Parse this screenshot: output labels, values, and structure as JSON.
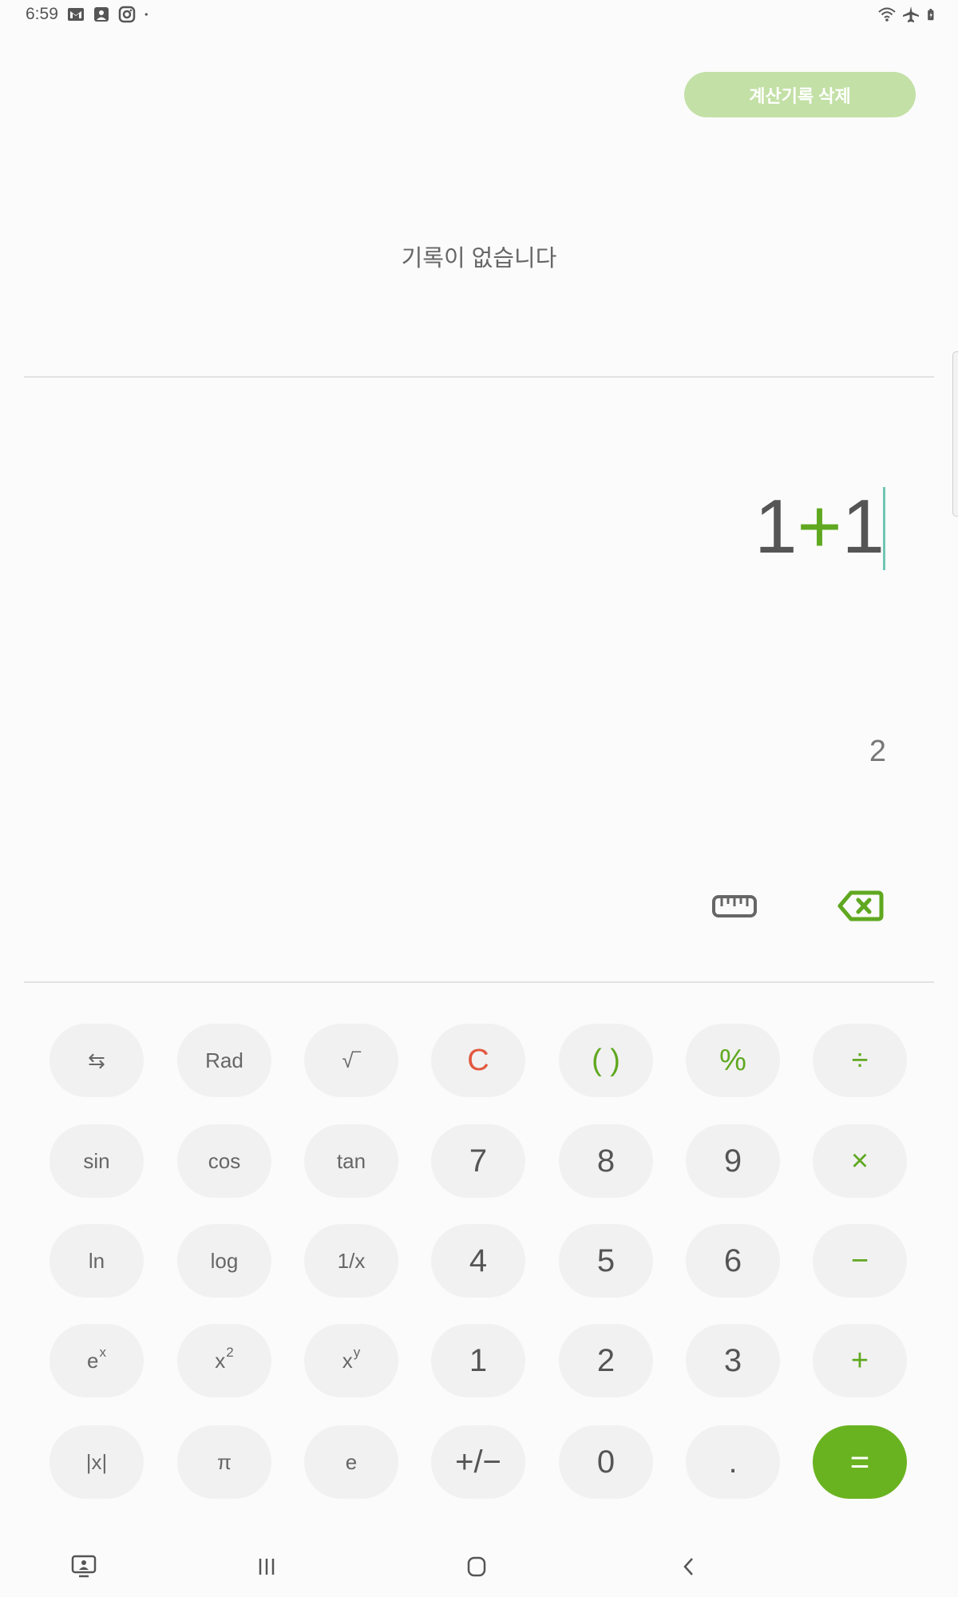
{
  "status_bar": {
    "time": "6:59",
    "left_icons": [
      "gmail-icon",
      "image-notification-icon",
      "instagram-icon",
      "notification-dot-icon"
    ],
    "right_icons": [
      "wifi-icon",
      "airplane-mode-icon",
      "battery-icon"
    ]
  },
  "history": {
    "clear_label": "계산기록 삭제",
    "empty_text": "기록이 없습니다"
  },
  "display": {
    "expression_parts": [
      "1",
      "+",
      "1"
    ],
    "result": "2"
  },
  "keypad": {
    "rows": [
      [
        {
          "label": "⇆",
          "kind": "fn",
          "name": "swap-keypad-key"
        },
        {
          "label": "Rad",
          "kind": "fn",
          "name": "rad-key"
        },
        {
          "label": "√‾",
          "kind": "fn",
          "name": "sqrt-key"
        },
        {
          "label": "C",
          "kind": "clear",
          "name": "clear-key"
        },
        {
          "label": "( )",
          "kind": "op",
          "name": "parentheses-key"
        },
        {
          "label": "%",
          "kind": "op",
          "name": "percent-key"
        },
        {
          "label": "÷",
          "kind": "op",
          "name": "divide-key"
        }
      ],
      [
        {
          "label": "sin",
          "kind": "fn",
          "name": "sin-key"
        },
        {
          "label": "cos",
          "kind": "fn",
          "name": "cos-key"
        },
        {
          "label": "tan",
          "kind": "fn",
          "name": "tan-key"
        },
        {
          "label": "7",
          "kind": "num",
          "name": "digit-7-key"
        },
        {
          "label": "8",
          "kind": "num",
          "name": "digit-8-key"
        },
        {
          "label": "9",
          "kind": "num",
          "name": "digit-9-key"
        },
        {
          "label": "×",
          "kind": "op",
          "name": "multiply-key"
        }
      ],
      [
        {
          "label": "ln",
          "kind": "fn",
          "name": "ln-key"
        },
        {
          "label": "log",
          "kind": "fn",
          "name": "log-key"
        },
        {
          "label": "1/x",
          "kind": "fn",
          "name": "reciprocal-key"
        },
        {
          "label": "4",
          "kind": "num",
          "name": "digit-4-key"
        },
        {
          "label": "5",
          "kind": "num",
          "name": "digit-5-key"
        },
        {
          "label": "6",
          "kind": "num",
          "name": "digit-6-key"
        },
        {
          "label": "−",
          "kind": "op",
          "name": "minus-key"
        }
      ],
      [
        {
          "label": "e",
          "sup": "x",
          "kind": "fn",
          "name": "exp-key"
        },
        {
          "label": "x",
          "sup": "2",
          "kind": "fn",
          "name": "square-key"
        },
        {
          "label": "x",
          "sup": "y",
          "kind": "fn",
          "name": "power-key"
        },
        {
          "label": "1",
          "kind": "num",
          "name": "digit-1-key"
        },
        {
          "label": "2",
          "kind": "num",
          "name": "digit-2-key"
        },
        {
          "label": "3",
          "kind": "num",
          "name": "digit-3-key"
        },
        {
          "label": "+",
          "kind": "op",
          "name": "plus-key"
        }
      ],
      [
        {
          "label": "|x|",
          "kind": "fn",
          "name": "abs-key"
        },
        {
          "label": "π",
          "kind": "fn",
          "name": "pi-key"
        },
        {
          "label": "e",
          "kind": "fn",
          "name": "euler-key"
        },
        {
          "label": "+/−",
          "kind": "num",
          "name": "sign-toggle-key"
        },
        {
          "label": "0",
          "kind": "num",
          "name": "digit-0-key"
        },
        {
          "label": ".",
          "kind": "num",
          "name": "decimal-key"
        },
        {
          "label": "=",
          "kind": "equals",
          "name": "equals-key"
        }
      ]
    ]
  },
  "colors": {
    "accent": "#6ab320",
    "clear": "#e2573f",
    "cursor": "#6fc5b4",
    "history_button": "#c3e0a6"
  },
  "nav_bar": [
    "recent-screens-icon",
    "recents-icon",
    "home-icon",
    "back-icon"
  ]
}
